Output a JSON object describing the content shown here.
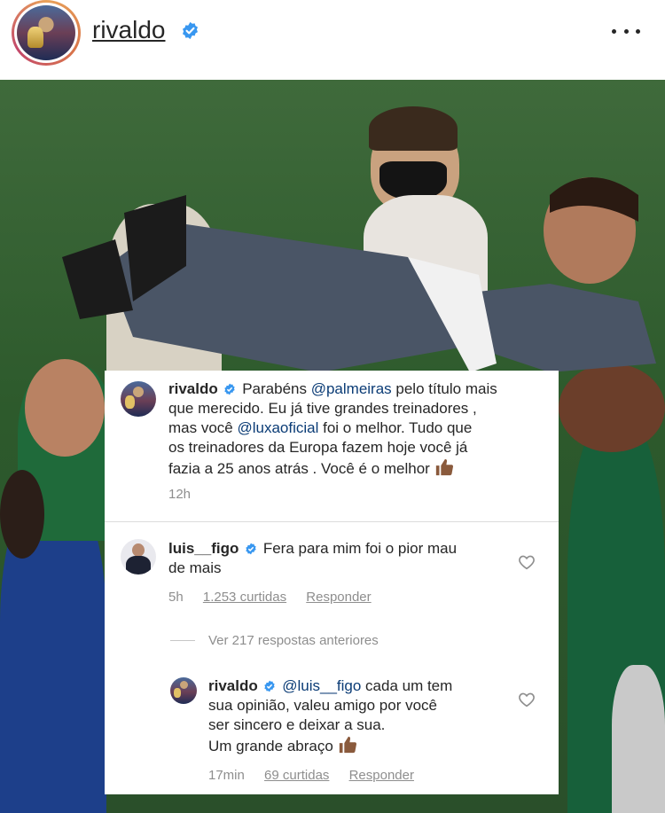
{
  "header": {
    "username": "rivaldo",
    "more_icon": "more-horizontal-icon"
  },
  "post_comment": {
    "author": "rivaldo",
    "text_parts": {
      "p1": "Parabéns ",
      "mention1": "@palmeiras",
      "p2": " pelo título mais",
      "line2": "que merecido. Eu já tive grandes treinadores ,",
      "p3": "mas você ",
      "mention2": "@luxaoficial",
      "p4": " foi o melhor. Tudo que",
      "line4": "os treinadores da Europa fazem  hoje você já",
      "line5": "fazia a 25 anos atrás . Você é o melhor"
    },
    "time": "12h"
  },
  "reply_comment": {
    "author": "luis__figo",
    "line1": "Fera para mim foi o pior mau",
    "line2": "de mais",
    "time": "5h",
    "likes": "1.253 curtidas",
    "reply_label": "Responder"
  },
  "view_replies": "Ver 217 respostas anteriores",
  "nested_reply": {
    "author": "rivaldo",
    "mention": "@luis__figo",
    "p1": " cada um tem",
    "line2": "sua opinião, valeu amigo por você",
    "line3": "ser sincero e deixar a sua.",
    "line4": "Um grande abraço",
    "time": "17min",
    "likes": "69 curtidas",
    "reply_label": "Responder"
  },
  "colors": {
    "verified_blue": "#3897f0",
    "mention": "#0b3c76",
    "muted": "#8e8e8e",
    "text": "#262626"
  }
}
